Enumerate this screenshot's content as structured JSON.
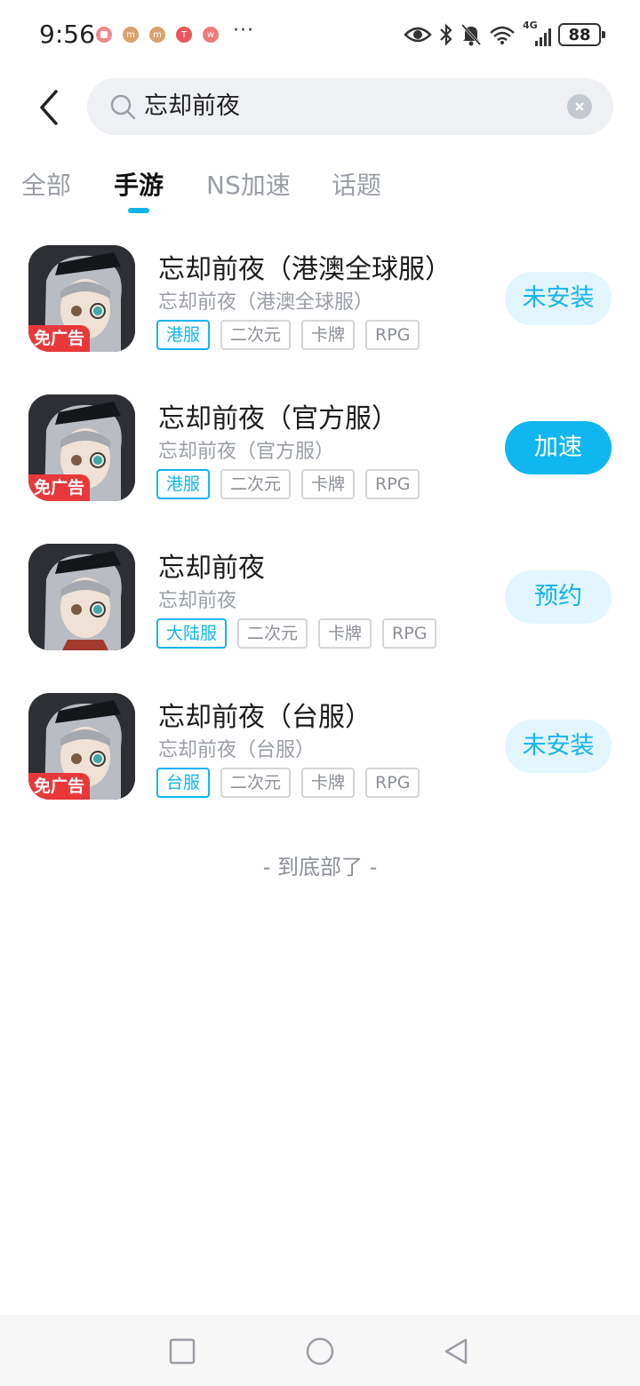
{
  "status_bar": {
    "time": "9:56",
    "battery": "88",
    "network": "4G"
  },
  "search": {
    "query": "忘却前夜"
  },
  "tabs": [
    {
      "label": "全部"
    },
    {
      "label": "手游",
      "active": true
    },
    {
      "label": "NS加速"
    },
    {
      "label": "话题"
    }
  ],
  "results": [
    {
      "title": "忘却前夜（港澳全球服）",
      "subtitle": "忘却前夜（港澳全球服）",
      "badge": "免广告",
      "tags": [
        "港服",
        "二次元",
        "卡牌",
        "RPG"
      ],
      "action": "未安装"
    },
    {
      "title": "忘却前夜（官方服）",
      "subtitle": "忘却前夜（官方服）",
      "badge": "免广告",
      "tags": [
        "港服",
        "二次元",
        "卡牌",
        "RPG"
      ],
      "action": "加速"
    },
    {
      "title": "忘却前夜",
      "subtitle": "忘却前夜",
      "badge": "",
      "tags": [
        "大陆服",
        "二次元",
        "卡牌",
        "RPG"
      ],
      "action": "预约"
    },
    {
      "title": "忘却前夜（台服）",
      "subtitle": "忘却前夜（台服）",
      "badge": "免广告",
      "tags": [
        "台服",
        "二次元",
        "卡牌",
        "RPG"
      ],
      "action": "未安装"
    }
  ],
  "end_text": "- 到底部了 -",
  "colors": {
    "accent": "#12b4ee",
    "ad_badge": "#e8383a"
  }
}
